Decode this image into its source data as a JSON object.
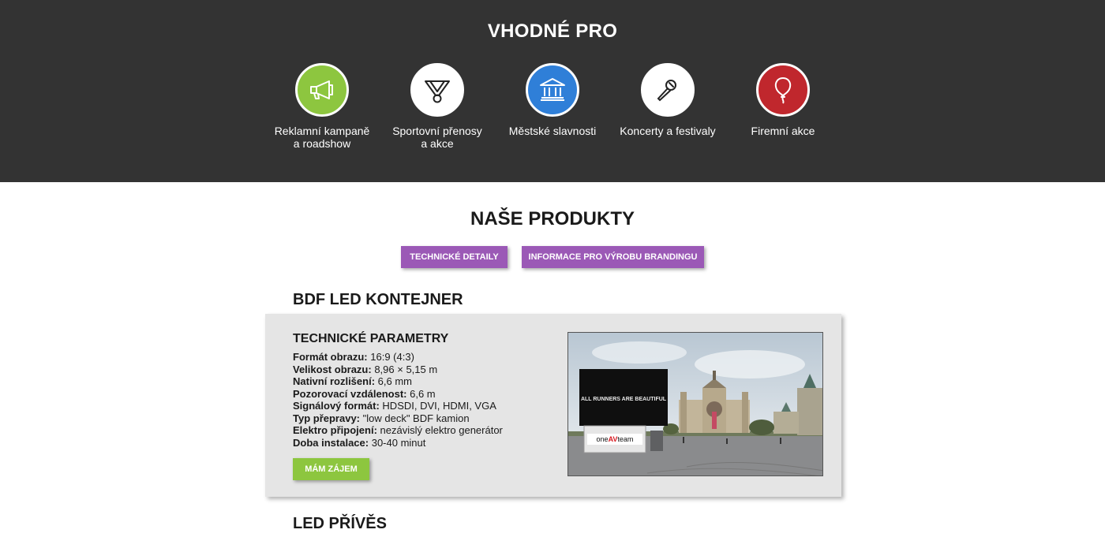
{
  "suitable": {
    "title": "VHODNÉ PRO",
    "items": [
      {
        "line1": "Reklamní kampaně",
        "line2": "a roadshow",
        "icon": "megaphone-icon",
        "color": "#8dc63f"
      },
      {
        "line1": "Sportovní přenosy",
        "line2": "a akce",
        "icon": "medal-icon",
        "color": "#ffffff"
      },
      {
        "line1": "Městské slavnosti",
        "line2": "",
        "icon": "town-hall-icon",
        "color": "#2f7fd8"
      },
      {
        "line1": "Koncerty a festivaly",
        "line2": "",
        "icon": "microphone-icon",
        "color": "#ffffff"
      },
      {
        "line1": "Firemní akce",
        "line2": "",
        "icon": "balloon-icon",
        "color": "#c0272d"
      }
    ]
  },
  "products": {
    "title": "NAŠE PRODUKTY",
    "tech_button": "TECHNICKÉ DETAILY",
    "branding_button": "INFORMACE PRO VÝROBU BRANDINGU",
    "button_color": "#9b59b6"
  },
  "product1": {
    "name": "BDF LED KONTEJNER",
    "params_title": "TECHNICKÉ PARAMETRY",
    "params": [
      {
        "label": "Formát obrazu:",
        "value": "16:9 (4:3)"
      },
      {
        "label": "Velikost obrazu:",
        "value": "8,96 × 5,15 m"
      },
      {
        "label": "Nativní rozlišení:",
        "value": "6,6 mm"
      },
      {
        "label": "Pozorovací vzdálenost:",
        "value": "6,6 m"
      },
      {
        "label": "Signálový formát:",
        "value": "HDSDI, DVI, HDMI, VGA"
      },
      {
        "label": "Typ přepravy:",
        "value": "\"low deck\" BDF kamion"
      },
      {
        "label": "Elektro připojení:",
        "value": "nezávislý elektro generátor"
      },
      {
        "label": "Doba instalace:",
        "value": "30-40 minut"
      }
    ],
    "cta": "MÁM ZÁJEM",
    "cta_color": "#8dc63f",
    "photo": {
      "screen_text": "ALL RUNNERS ARE BEAUTIFUL",
      "brand_pre": "one",
      "brand_av": "AV",
      "brand_post": "team"
    }
  },
  "product2": {
    "name": "LED PŘÍVĚS"
  }
}
